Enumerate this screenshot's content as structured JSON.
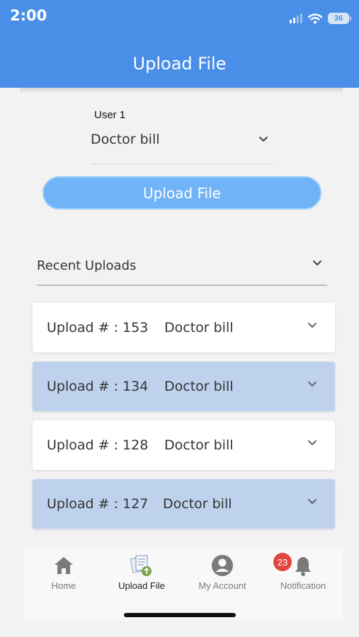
{
  "status_bar": {
    "time": "2:00",
    "battery": "36",
    "icons": [
      "signal-icon",
      "wifi-icon",
      "battery-icon"
    ]
  },
  "header": {
    "title": "Upload File"
  },
  "form": {
    "user_label": "User 1",
    "document_type": "Doctor bill",
    "upload_button": "Upload File"
  },
  "recent": {
    "label": "Recent Uploads",
    "items": [
      {
        "id_text": "Upload # : 153",
        "name": "Doctor bill"
      },
      {
        "id_text": "Upload # : 134",
        "name": "Doctor bill"
      },
      {
        "id_text": "Upload # : 128",
        "name": "Doctor bill"
      },
      {
        "id_text": "Upload # : 127",
        "name": "Doctor bill"
      }
    ]
  },
  "tabs": [
    {
      "label": "Home",
      "icon": "home-icon"
    },
    {
      "label": "Upload File",
      "icon": "upload-file-icon"
    },
    {
      "label": "My Account",
      "icon": "account-icon"
    },
    {
      "label": "Notification",
      "icon": "bell-icon"
    }
  ],
  "notification_badge": "23",
  "colors": {
    "header": "#4a8fe7",
    "button": "#70b3f6",
    "row_alt": "#bed2ee",
    "badge": "#e2453c"
  }
}
